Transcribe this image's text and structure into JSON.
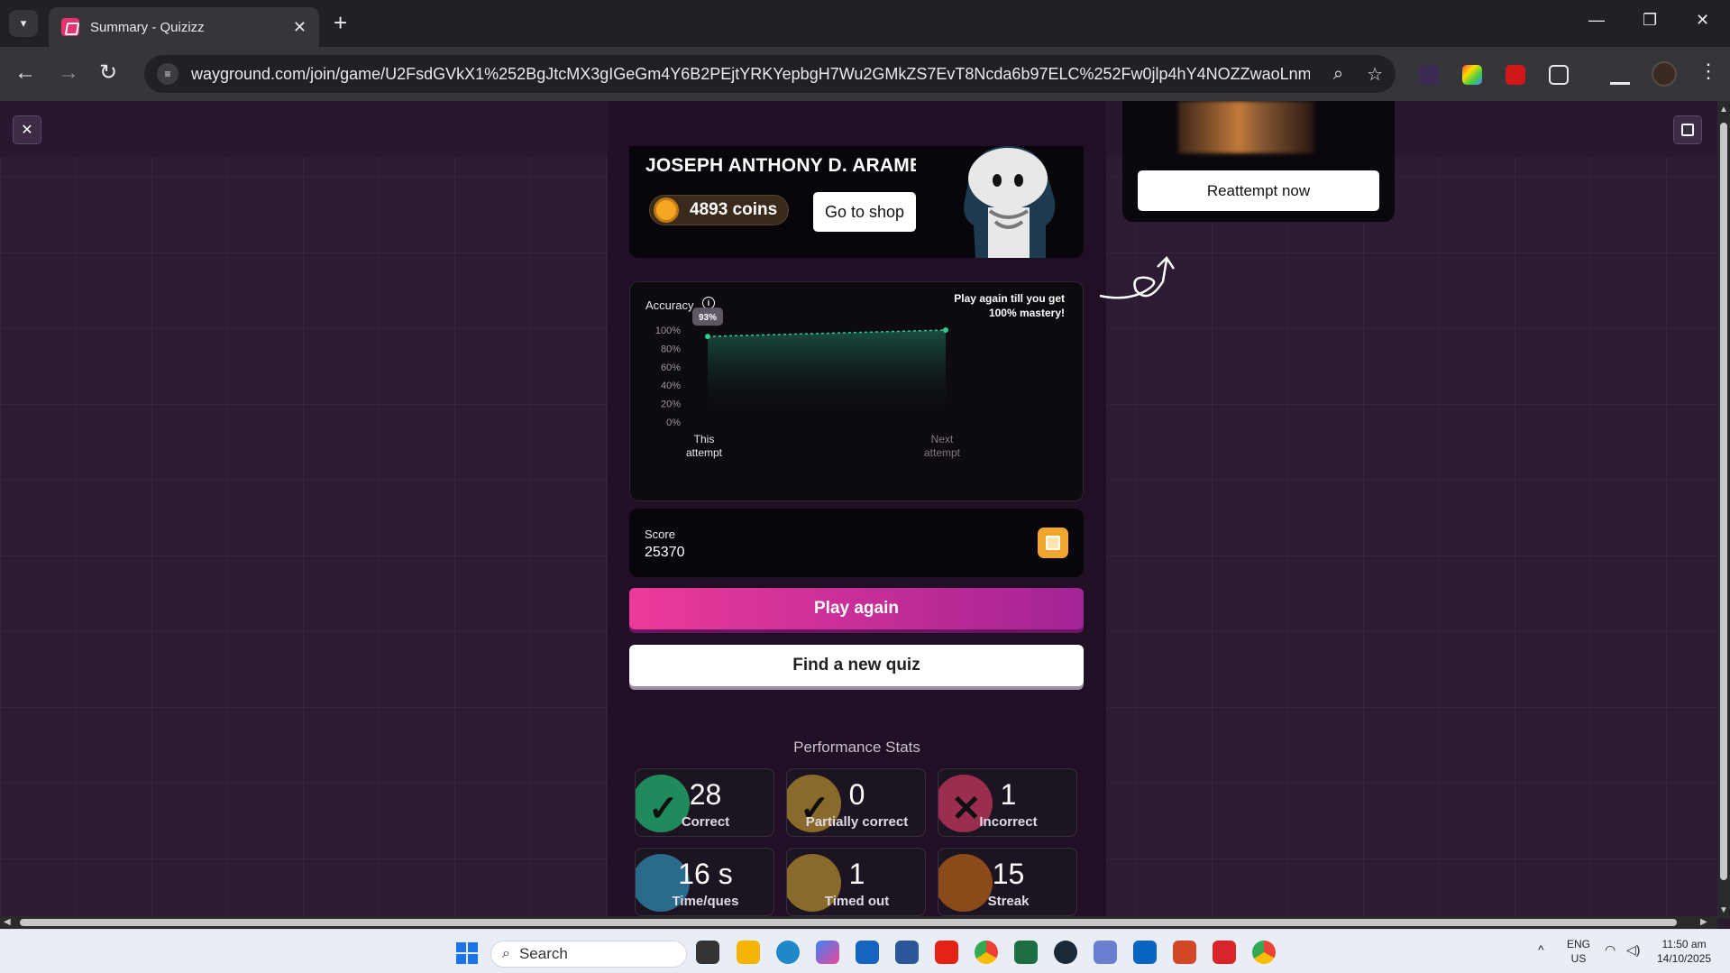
{
  "browser": {
    "tab_title": "Summary - Quizizz",
    "url": "wayground.com/join/game/U2FsdGVkX1%252BgJtcMX3gIGeGm4Y6B2PEjtYRKYepbgH7Wu2GMkZS7EvT8Ncda6b97ELC%252Fw0jlp4hY4NOZZwaoLnm%..."
  },
  "profile": {
    "name": "JOSEPH ANTHONY D. ARAMBA",
    "coins": "4893 coins",
    "shop_label": "Go to shop"
  },
  "accuracy": {
    "label": "Accuracy",
    "mastery_text": "Play again till you get 100% mastery!",
    "badge": "93%"
  },
  "chart_data": {
    "type": "area",
    "title": "Accuracy",
    "categories": [
      "This attempt",
      "Next attempt"
    ],
    "values": [
      93,
      100
    ],
    "yticks": [
      "100%",
      "80%",
      "60%",
      "40%",
      "20%",
      "0%"
    ],
    "ylim": [
      0,
      100
    ],
    "line_style": "dashed",
    "line_color": "#2ecc8f"
  },
  "score": {
    "label": "Score",
    "value": "25370"
  },
  "buttons": {
    "play_again": "Play again",
    "find_quiz": "Find a new quiz",
    "reattempt": "Reattempt now"
  },
  "performance": {
    "title": "Performance Stats",
    "stats": [
      {
        "value": "28",
        "label": "Correct",
        "color": "#1f8a5b",
        "glyph": "✓"
      },
      {
        "value": "0",
        "label": "Partially correct",
        "color": "#8a6a2a",
        "glyph": "✓"
      },
      {
        "value": "1",
        "label": "Incorrect",
        "color": "#9b2d4e",
        "glyph": "✕"
      },
      {
        "value": "16 s",
        "label": "Time/ques",
        "color": "#2a6a8a",
        "glyph": ""
      },
      {
        "value": "1",
        "label": "Timed out",
        "color": "#8a6a2a",
        "glyph": ""
      },
      {
        "value": "15",
        "label": "Streak",
        "color": "#8a4a1a",
        "glyph": ""
      }
    ]
  },
  "taskbar": {
    "search_placeholder": "Search",
    "lang_top": "ENG",
    "lang_bottom": "US",
    "time": "11:50 am",
    "date": "14/10/2025"
  }
}
